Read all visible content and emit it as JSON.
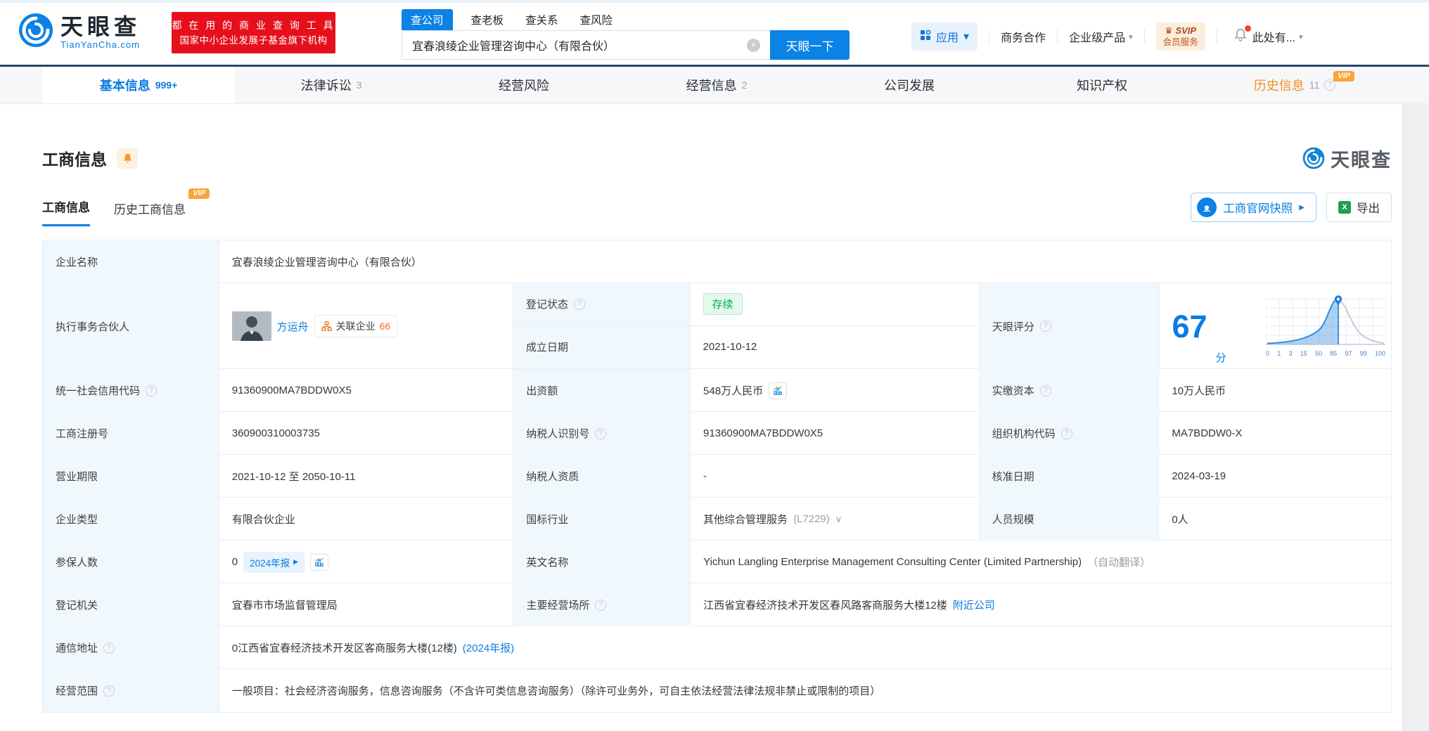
{
  "meta": {
    "brand": "天眼查",
    "brand_domain": "TianYanCha.com"
  },
  "colors": {
    "accent": "#0b7ce0",
    "brand_red": "#e6101c",
    "vip_orange": "#f9a53a",
    "status_green": "#00ad5f"
  },
  "icons": {
    "dropdown": "▾",
    "play": "▶",
    "collapse": "∨",
    "clear": "×",
    "help": "?",
    "crown": "♛",
    "excel": "X"
  },
  "header": {
    "slogan_line1": "都 在 用 的 商 业 查 询 工 具",
    "slogan_line2": "国家中小企业发展子基金旗下机构",
    "search": {
      "tabs": [
        "查公司",
        "查老板",
        "查关系",
        "查风险"
      ],
      "value": "宜春浪绫企业管理咨询中心（有限合伙）",
      "button": "天眼一下"
    },
    "nav": {
      "apps": "应用",
      "cooperation": "商务合作",
      "enterprise": "企业级产品",
      "svip_top": "SVIP",
      "svip_bottom": "会员服务",
      "account": "此处有..."
    }
  },
  "tabs": [
    {
      "label": "基本信息",
      "badge": "999+"
    },
    {
      "label": "法律诉讼",
      "badge": "3"
    },
    {
      "label": "经营风险",
      "badge": ""
    },
    {
      "label": "经营信息",
      "badge": "2"
    },
    {
      "label": "公司发展",
      "badge": ""
    },
    {
      "label": "知识产权",
      "badge": ""
    },
    {
      "label": "历史信息",
      "badge": "11",
      "vip": "VIP"
    }
  ],
  "section": {
    "title": "工商信息",
    "watermark": "天眼查",
    "subtab_active": "工商信息",
    "subtab_history": "历史工商信息",
    "vip": "VIP",
    "snapshot_button": "工商官网快照",
    "export_button": "导出"
  },
  "table": {
    "company_name_label": "企业名称",
    "company_name": "宜春浪绫企业管理咨询中心（有限合伙）",
    "partner_label": "执行事务合伙人",
    "partner_name": "方运舟",
    "related_label": "关联企业",
    "related_count": "66",
    "reg_status_label": "登记状态",
    "reg_status": "存续",
    "establish_label": "成立日期",
    "establish_date": "2021-10-12",
    "score_label": "天眼评分",
    "credit_code_label": "统一社会信用代码",
    "credit_code": "91360900MA7BDDW0X5",
    "capital_label": "出资额",
    "capital": "548万人民币",
    "paid_capital_label": "实缴资本",
    "paid_capital": "10万人民币",
    "reg_no_label": "工商注册号",
    "reg_no": "360900310003735",
    "taxpayer_id_label": "纳税人识别号",
    "taxpayer_id": "91360900MA7BDDW0X5",
    "org_code_label": "组织机构代码",
    "org_code": "MA7BDDW0-X",
    "term_label": "营业期限",
    "term": "2021-10-12 至 2050-10-11",
    "taxpayer_quality_label": "纳税人资质",
    "taxpayer_quality": "-",
    "approval_label": "核准日期",
    "approval_date": "2024-03-19",
    "type_label": "企业类型",
    "type": "有限合伙企业",
    "industry_label": "国标行业",
    "industry": "其他综合管理服务",
    "industry_code": "(L7229)",
    "staff_label": "人员规模",
    "staff": "0人",
    "insured_label": "参保人数",
    "insured": "0",
    "annual_report_chip": "2024年报",
    "en_name_label": "英文名称",
    "en_name": "Yichun Langling Enterprise Management Consulting Center (Limited Partnership)",
    "en_name_note": "（自动翻译）",
    "authority_label": "登记机关",
    "authority": "宜春市市场监督管理局",
    "address_label": "主要经营场所",
    "address": "江西省宜春经济技术开发区春风路客商服务大楼12楼",
    "nearby_link": "附近公司",
    "mail_label": "通信地址",
    "mail_address": "0江西省宜春经济技术开发区客商服务大楼(12楼)",
    "mail_report_link": "(2024年报)",
    "scope_label": "经营范围",
    "scope": "一般项目：社会经济咨询服务，信息咨询服务（不含许可类信息咨询服务）（除许可业务外，可自主依法经营法律法规非禁止或限制的项目）"
  },
  "chart_data": {
    "type": "area",
    "description": "天眼评分 percentile bell curve",
    "score": 67,
    "score_unit": "分",
    "marker_value": 67,
    "x_ticks": [
      0,
      1,
      3,
      15,
      50,
      85,
      97,
      99,
      100
    ],
    "highlight_range": [
      0,
      67
    ],
    "grid": true
  }
}
